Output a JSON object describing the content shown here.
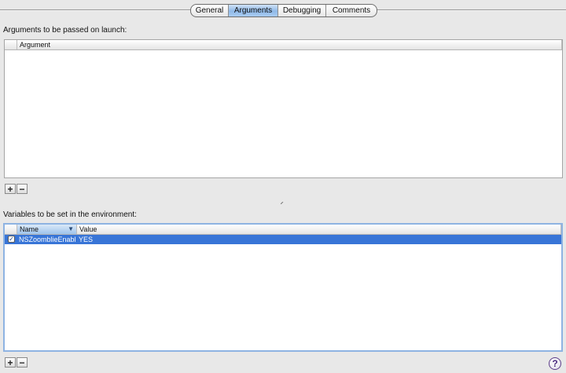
{
  "tabs": [
    {
      "label": "General",
      "active": false
    },
    {
      "label": "Arguments",
      "active": true
    },
    {
      "label": "Debugging",
      "active": false
    },
    {
      "label": "Comments",
      "active": false
    }
  ],
  "arguments_section": {
    "label": "Arguments to be passed on launch:",
    "columns": [
      "Argument"
    ],
    "rows": []
  },
  "environment_section": {
    "label": "Variables to be set in the environment:",
    "columns": [
      "Name",
      "Value"
    ],
    "sorted_column": "Name",
    "rows": [
      {
        "enabled": true,
        "name": "NSZoomblieEnabl",
        "value": "YES",
        "selected": true
      }
    ]
  },
  "buttons": {
    "add": "+",
    "remove": "−",
    "help": "?"
  },
  "colors": {
    "selection": "#3875d7",
    "focus_ring": "#8eb3e2",
    "active_tab": "#8fb9e8"
  },
  "icons": [
    "check-icon",
    "sort-descending-icon",
    "splitter-handle-icon",
    "help-icon"
  ]
}
